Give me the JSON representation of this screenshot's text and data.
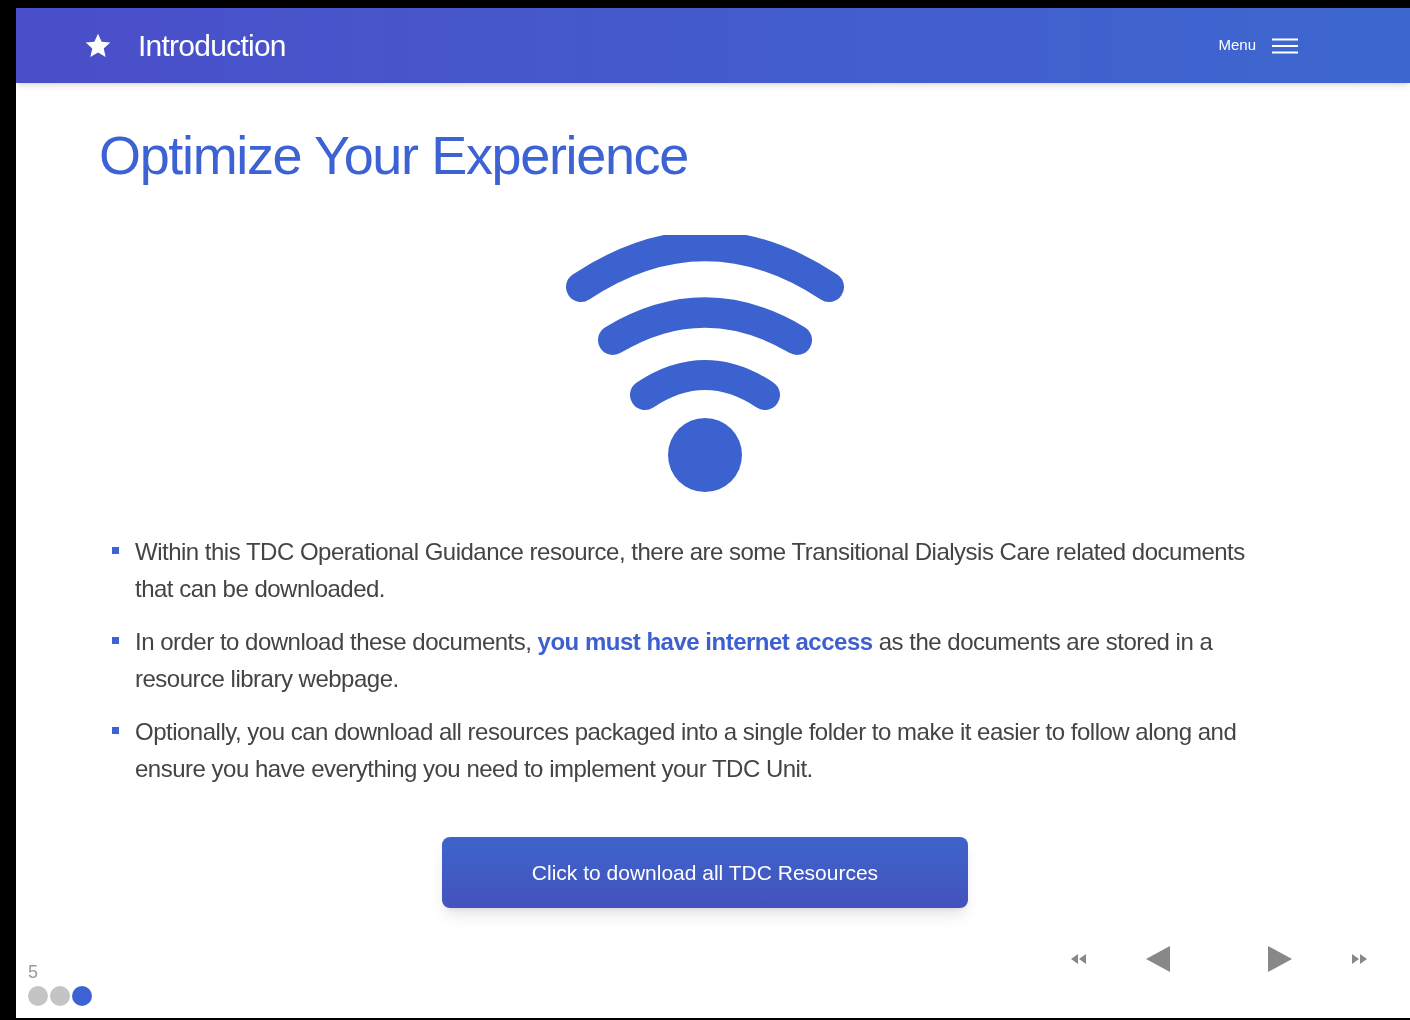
{
  "header": {
    "title": "Introduction",
    "menu_label": "Menu"
  },
  "heading": "Optimize Your Experience",
  "bullets": [
    "Within this TDC Operational Guidance resource, there are some Transitional Dialysis Care related documents that can be downloaded.",
    "In order to download these documents, **you must have internet access** as the documents are stored in a resource library webpage.",
    "Optionally, you can download all resources packaged into a single folder to make it easier to follow along and ensure you have everything you need to implement your TDC Unit."
  ],
  "download_button": "Click to download all TDC Resources",
  "footer": {
    "page_number": "5",
    "progress": [
      {
        "selected": false
      },
      {
        "selected": false
      },
      {
        "selected": true
      }
    ]
  }
}
